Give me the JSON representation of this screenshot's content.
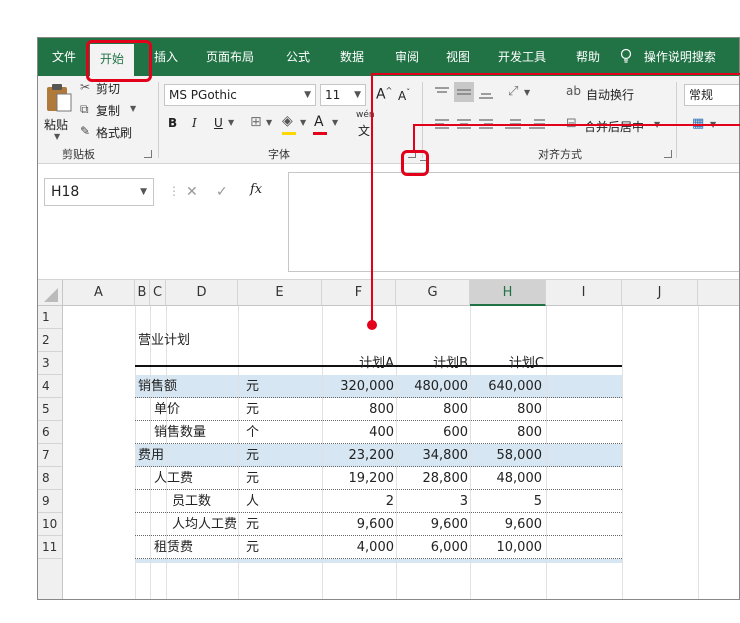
{
  "tabs": [
    "文件",
    "开始",
    "插入",
    "页面布局",
    "公式",
    "数据",
    "审阅",
    "视图",
    "开发工具",
    "帮助"
  ],
  "tell_me": "操作说明搜索",
  "clipboard": {
    "paste": "粘贴",
    "cut": "剪切",
    "copy": "复制",
    "format_painter": "格式刷",
    "label": "剪贴板"
  },
  "font": {
    "name": "MS PGothic",
    "size": "11",
    "bold": "B",
    "italic": "I",
    "underline": "U",
    "font_color_letter": "A",
    "phonetic": "wén",
    "label": "字体"
  },
  "alignment": {
    "wrap_text": "自动换行",
    "merge_center": "合并后居中",
    "label": "对齐方式"
  },
  "number": {
    "format": "常规"
  },
  "formula_bar": {
    "name_box": "H18",
    "fx": "fx",
    "cancel": "✕",
    "enter": "✓"
  },
  "columns": [
    "A",
    "B",
    "C",
    "D",
    "E",
    "F",
    "G",
    "H",
    "I",
    "J"
  ],
  "rows": [
    "1",
    "2",
    "3",
    "4",
    "5",
    "6",
    "7",
    "8",
    "9",
    "10",
    "11"
  ],
  "sheet": {
    "title": "营业计划",
    "headers": [
      "计划A",
      "计划B",
      "计划C"
    ],
    "lines": [
      {
        "label": "销售额",
        "unit": "元",
        "a": "320,000",
        "b": "480,000",
        "c": "640,000"
      },
      {
        "label": "单价",
        "unit": "元",
        "a": "800",
        "b": "800",
        "c": "800"
      },
      {
        "label": "销售数量",
        "unit": "个",
        "a": "400",
        "b": "600",
        "c": "800"
      },
      {
        "label": "费用",
        "unit": "元",
        "a": "23,200",
        "b": "34,800",
        "c": "58,000"
      },
      {
        "label": "人工费",
        "unit": "元",
        "a": "19,200",
        "b": "28,800",
        "c": "48,000"
      },
      {
        "label": "员工数",
        "unit": "人",
        "a": "2",
        "b": "3",
        "c": "5"
      },
      {
        "label": "人均人工费",
        "unit": "元",
        "a": "9,600",
        "b": "9,600",
        "c": "9,600"
      },
      {
        "label": "租赁费",
        "unit": "元",
        "a": "4,000",
        "b": "6,000",
        "c": "10,000"
      }
    ]
  },
  "colors": {
    "excel_green": "#217346",
    "annotation_red": "#e2001a",
    "row_band": "#d6e6f2"
  }
}
